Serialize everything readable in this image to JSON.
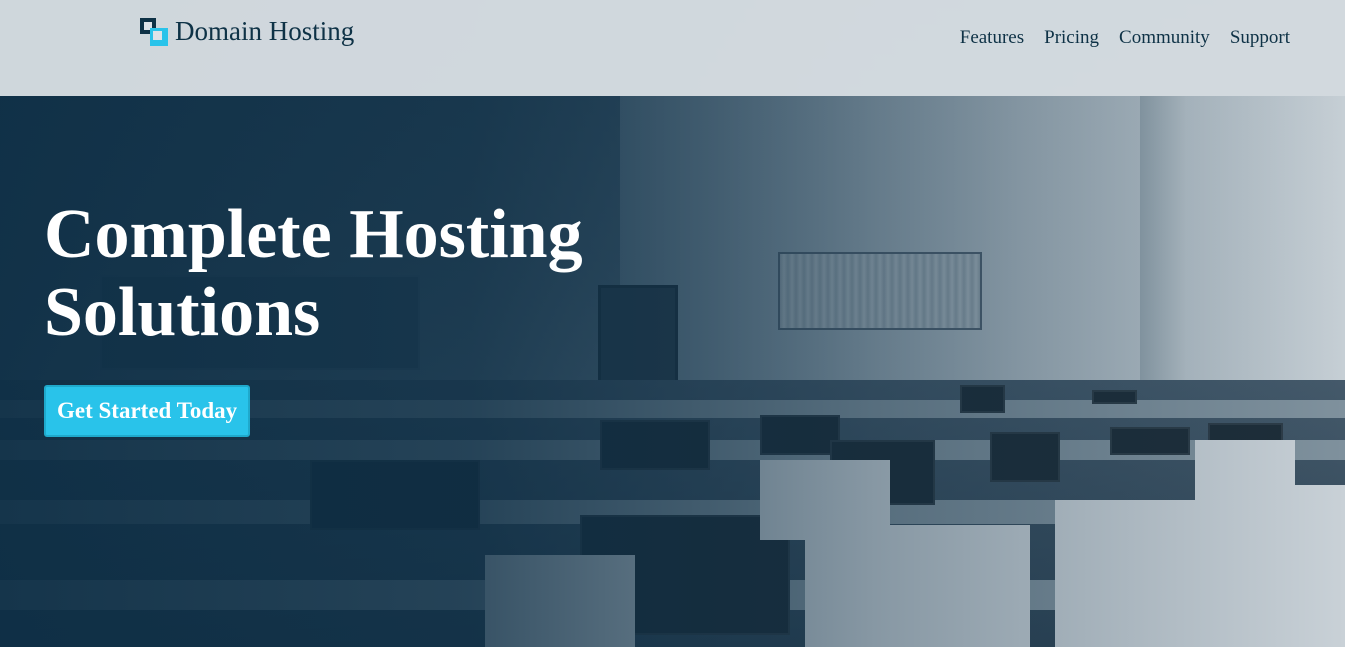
{
  "header": {
    "brand": "Domain Hosting",
    "nav": [
      {
        "label": "Features"
      },
      {
        "label": "Pricing"
      },
      {
        "label": "Community"
      },
      {
        "label": "Support"
      }
    ]
  },
  "hero": {
    "title_line1": "Complete Hosting",
    "title_line2": "Solutions",
    "cta_label": "Get Started Today",
    "background_image": "computer lab with rows of monitors and headphones"
  },
  "colors": {
    "brand_dark": "#0e3246",
    "accent": "#29c3ea",
    "header_bg": "#dde3e8",
    "overlay": "#0c2d44"
  }
}
